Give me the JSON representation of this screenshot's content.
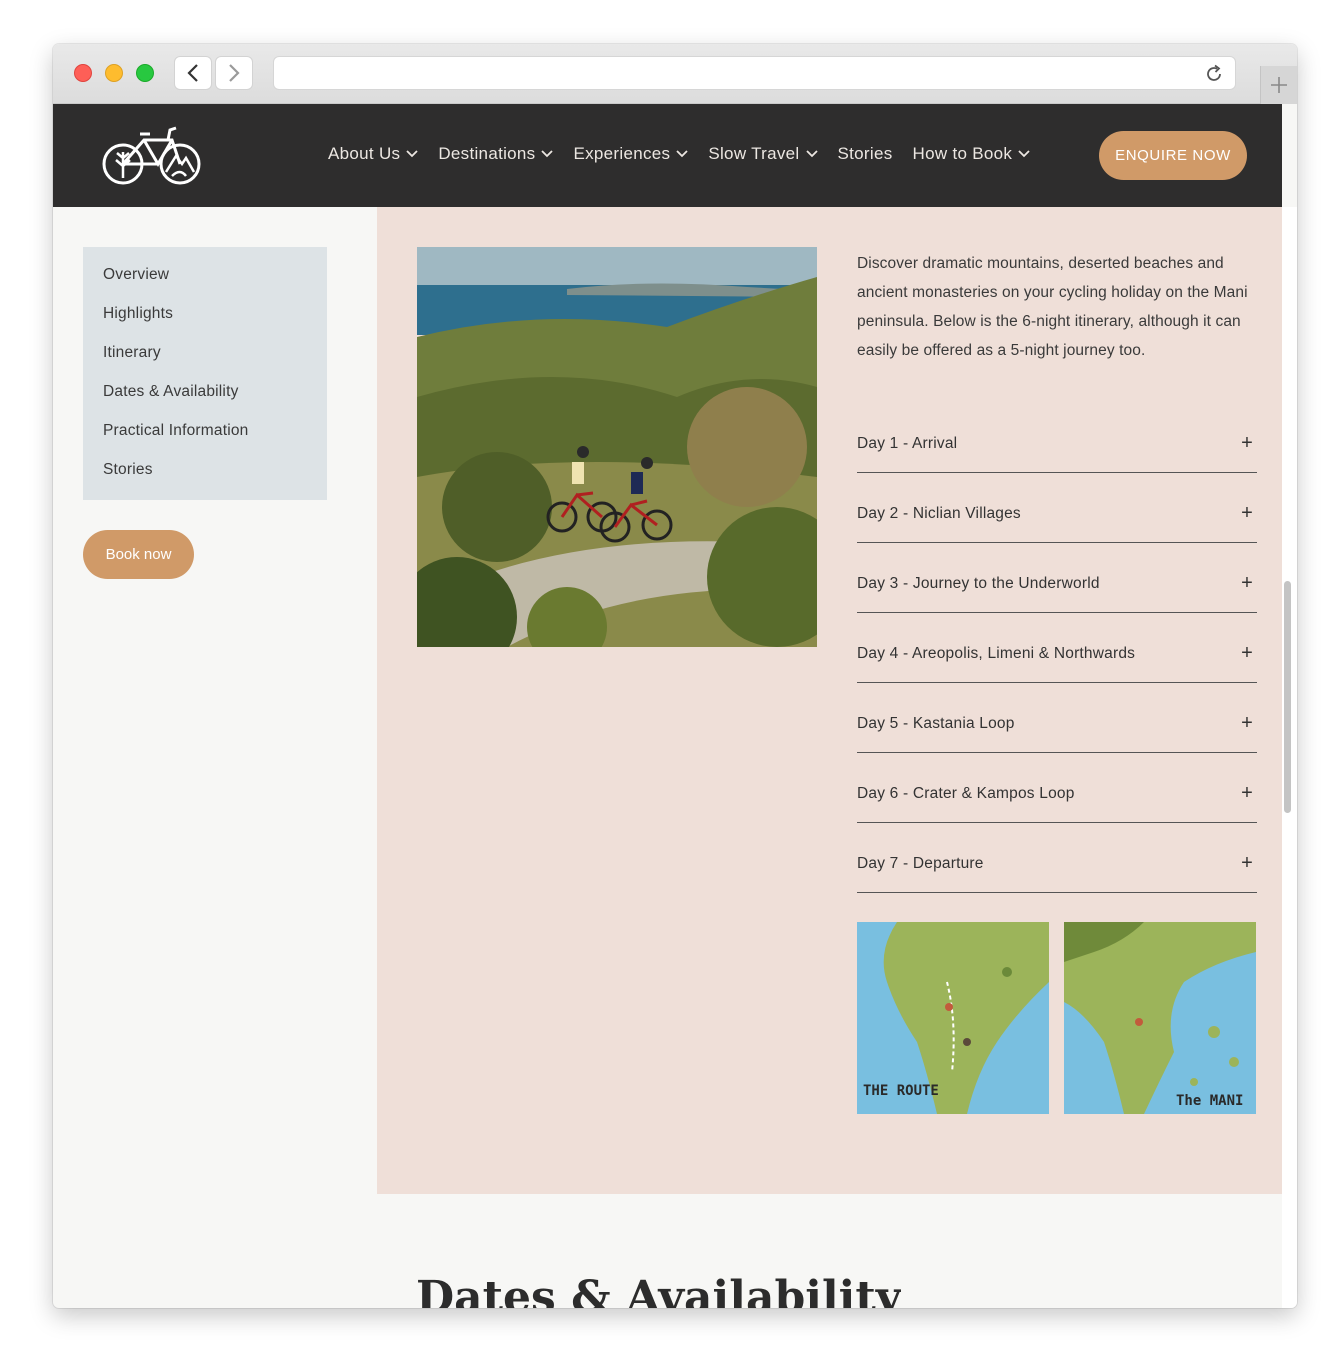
{
  "nav": {
    "items": [
      {
        "label": "About Us",
        "dropdown": true
      },
      {
        "label": "Destinations",
        "dropdown": true
      },
      {
        "label": "Experiences",
        "dropdown": true
      },
      {
        "label": "Slow Travel",
        "dropdown": true
      },
      {
        "label": "Stories",
        "dropdown": false
      },
      {
        "label": "How to Book",
        "dropdown": true
      }
    ],
    "cta": "ENQUIRE NOW"
  },
  "sidebar": {
    "items": [
      {
        "label": "Overview"
      },
      {
        "label": "Highlights"
      },
      {
        "label": "Itinerary"
      },
      {
        "label": "Dates & Availability"
      },
      {
        "label": "Practical Information"
      },
      {
        "label": "Stories"
      }
    ],
    "book_label": "Book now"
  },
  "intro": "Discover dramatic mountains, deserted beaches and ancient monasteries on your cycling holiday on the Mani peninsula. Below is the 6-night itinerary, although it can easily be offered as a 5-night journey too.",
  "itinerary": [
    {
      "label": "Day 1 - Arrival"
    },
    {
      "label": "Day 2 - Niclian Villages"
    },
    {
      "label": "Day 3 - Journey to the Underworld"
    },
    {
      "label": "Day 4 - Areopolis, Limeni & Northwards"
    },
    {
      "label": "Day 5 - Kastania Loop"
    },
    {
      "label": "Day 6 - Crater & Kampos Loop"
    },
    {
      "label": "Day 7 - Departure"
    }
  ],
  "maps": {
    "route_label": "THE ROUTE",
    "mani_label": "The MANI"
  },
  "next_section_title": "Dates & Availability",
  "colors": {
    "header_bg": "#2e2d2d",
    "accent": "#d09a68",
    "panel_bg": "#efdfd8",
    "sidebar_bg": "#dde3e6"
  }
}
